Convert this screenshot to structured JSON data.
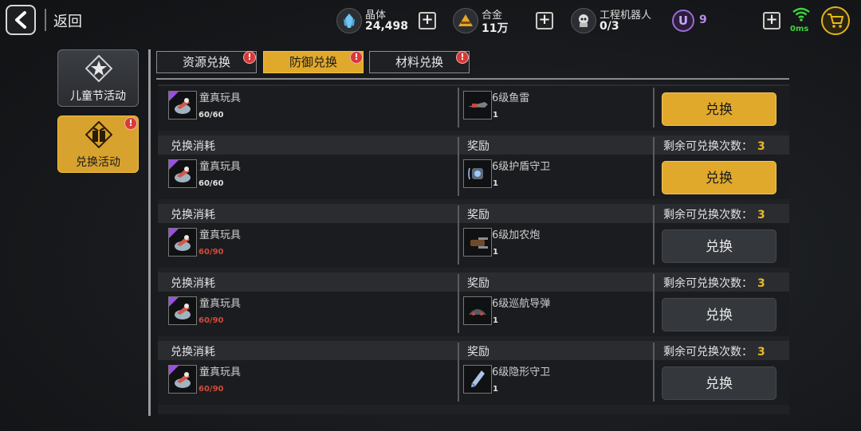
{
  "nav": {
    "back_label": "返回"
  },
  "resources": {
    "crystal": {
      "label": "晶体",
      "value": "24,498",
      "icon": "crystal-icon"
    },
    "alloy": {
      "label": "合金",
      "value": "11万",
      "icon": "alloy-icon"
    },
    "robot": {
      "label": "工程机器人",
      "value": "0/3",
      "icon": "robot-icon"
    },
    "uni": {
      "symbol": "U",
      "value": "9"
    },
    "ping": "0ms"
  },
  "sidebar": {
    "items": [
      {
        "label": "儿童节活动",
        "active": false
      },
      {
        "label": "兑换活动",
        "active": true,
        "badge": "!"
      }
    ]
  },
  "tabs": [
    {
      "label": "资源兑换",
      "active": false,
      "badge": "!"
    },
    {
      "label": "防御兑换",
      "active": true,
      "badge": "!"
    },
    {
      "label": "材料兑换",
      "active": false,
      "badge": "!"
    }
  ],
  "headers": {
    "cost": "兑换消耗",
    "reward": "奖励",
    "remaining": "剩余可兑换次数："
  },
  "rows": [
    {
      "cost_name": "童真玩具",
      "cost_count": "60/60",
      "cost_short": false,
      "reward_name": "6级鱼雷",
      "reward_count": "1",
      "remaining": "",
      "button": "兑换",
      "enabled": true
    },
    {
      "cost_name": "童真玩具",
      "cost_count": "60/60",
      "cost_short": false,
      "reward_name": "6级护盾守卫",
      "reward_count": "1",
      "remaining": "3",
      "button": "兑换",
      "enabled": true
    },
    {
      "cost_name": "童真玩具",
      "cost_count": "60/90",
      "cost_short": true,
      "reward_name": "6级加农炮",
      "reward_count": "1",
      "remaining": "3",
      "button": "兑换",
      "enabled": false
    },
    {
      "cost_name": "童真玩具",
      "cost_count": "60/90",
      "cost_short": true,
      "reward_name": "6级巡航导弹",
      "reward_count": "1",
      "remaining": "3",
      "button": "兑换",
      "enabled": false
    },
    {
      "cost_name": "童真玩具",
      "cost_count": "60/90",
      "cost_short": true,
      "reward_name": "6级隐形守卫",
      "reward_count": "1",
      "remaining": "3",
      "button": "兑换",
      "enabled": false
    }
  ],
  "colors": {
    "accent": "#e1a92c",
    "shortage": "#d24a3a",
    "uni": "#9b6bd8",
    "ping": "#3ed43e"
  }
}
